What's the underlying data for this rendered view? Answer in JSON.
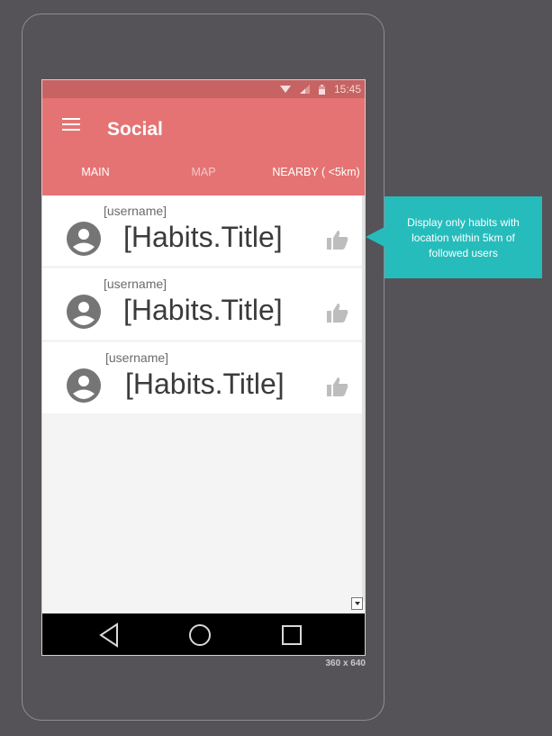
{
  "status_bar": {
    "time": "15:45"
  },
  "app_bar": {
    "title": "Social"
  },
  "tabs": [
    {
      "label": "MAIN"
    },
    {
      "label": "MAP"
    },
    {
      "label": "NEARBY ( <5km)"
    }
  ],
  "feed": [
    {
      "username": "[username]",
      "title": "[Habits.Title]"
    },
    {
      "username": "[username]",
      "title": "[Habits.Title]"
    },
    {
      "username": "[username]",
      "title": "[Habits.Title]"
    }
  ],
  "annotation": {
    "text": "Display only habits with location within 5km of followed users"
  },
  "frame_label": "360 x 640",
  "colors": {
    "app_bar": "#e57373",
    "status_bar": "#c76363",
    "annotation": "#26bcbc"
  }
}
